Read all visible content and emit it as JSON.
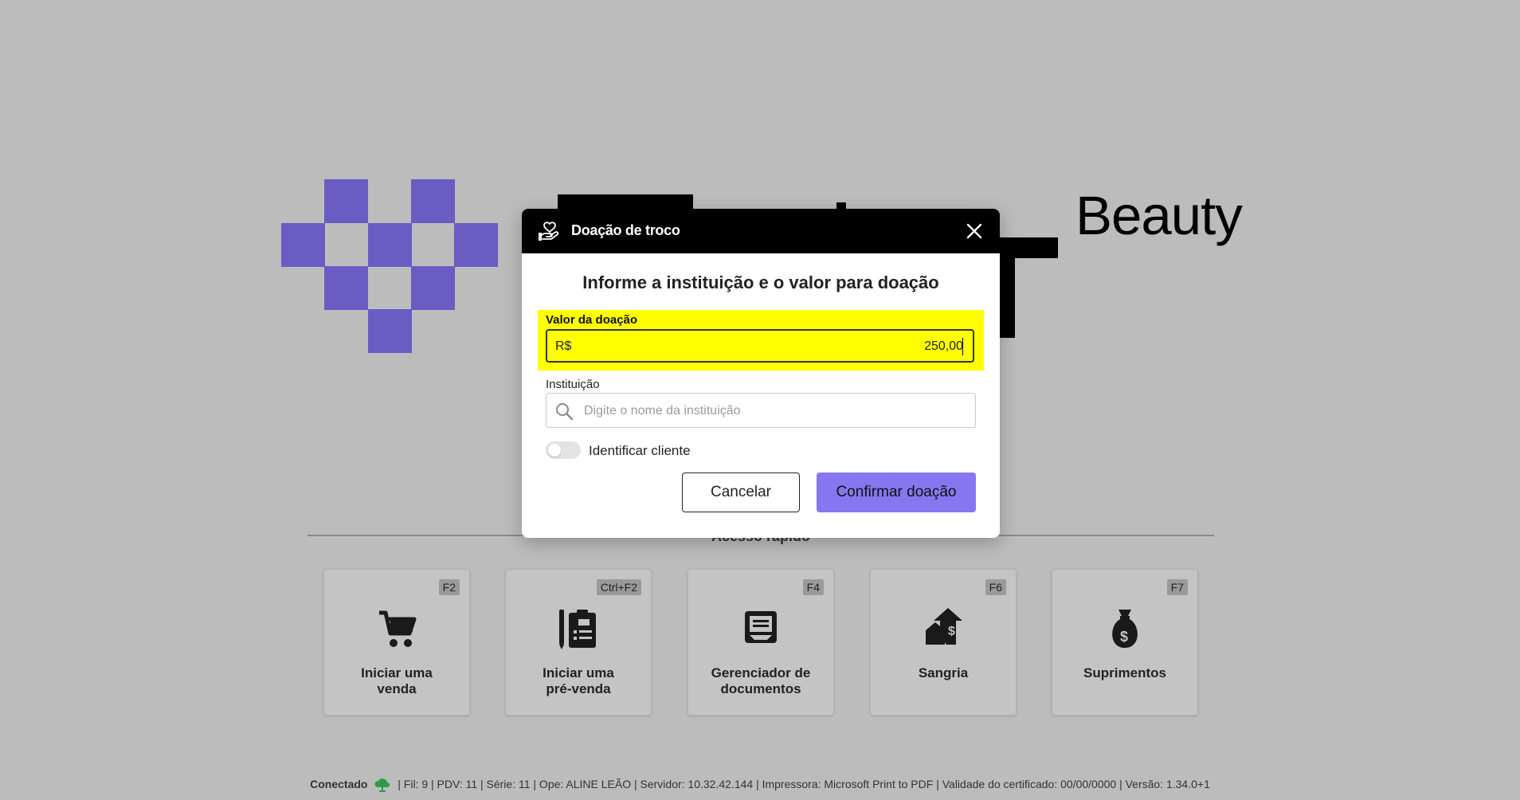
{
  "brand": {
    "name_suffix": "Beauty",
    "accent_color": "#6a5cc3"
  },
  "quick_access": {
    "title": "Acesso rápido",
    "cards": [
      {
        "key": "F2",
        "label": "Iniciar uma\nvenda",
        "icon": "cart-icon"
      },
      {
        "key": "Ctrl+F2",
        "label": "Iniciar uma\npré-venda",
        "icon": "pre-sale-clipboard-icon"
      },
      {
        "key": "F4",
        "label": "Gerenciador de\ndocumentos",
        "icon": "documents-icon"
      },
      {
        "key": "F6",
        "label": "Sangria",
        "icon": "withdrawal-icon"
      },
      {
        "key": "F7",
        "label": "Suprimentos",
        "icon": "money-bag-icon"
      }
    ]
  },
  "status_bar": {
    "connection": "Conectado",
    "details": "| Fil: 9 | PDV: 11 | Série: 11 | Ope: ALINE LEÃO | Servidor: 10.32.42.144 | Impressora: Microsoft Print to PDF | Validade do certificado: 00/00/0000 | Versão: 1.34.0+1",
    "connection_color": "#2e9b4a"
  },
  "modal": {
    "title": "Doação de troco",
    "heading": "Informe a instituição e o valor para doação",
    "value_field": {
      "label": "Valor da doação",
      "prefix": "R$",
      "value": "250,00",
      "highlight_color": "#ffff00"
    },
    "institution_field": {
      "label": "Instituição",
      "placeholder": "Digite o nome da instituição"
    },
    "toggle": {
      "label": "Identificar cliente",
      "on": false
    },
    "cancel_label": "Cancelar",
    "confirm_label": "Confirmar doação",
    "confirm_color": "#8676f0"
  }
}
